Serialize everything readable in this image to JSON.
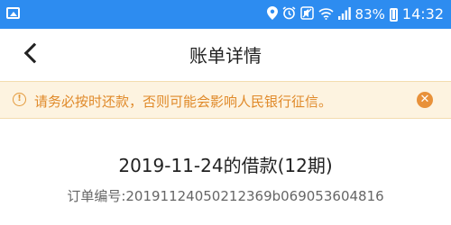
{
  "status_bar": {
    "battery_percent": "83%",
    "time": "14:32",
    "icons": [
      "location-icon",
      "alarm-icon",
      "mute-icon",
      "wifi-icon",
      "signal-icon",
      "battery-icon"
    ],
    "background_color": "#2d8cf0"
  },
  "nav": {
    "title": "账单详情",
    "back_icon": "chevron-left-icon"
  },
  "notice": {
    "text": "请务必按时还款，否则可能会影响人民银行征信。",
    "icon": "info-icon",
    "close_glyph": "✕",
    "color": "#e08a2a",
    "background_color": "#fdf3e0"
  },
  "loan": {
    "title": "2019-11-24的借款(12期)",
    "order_label": "订单编号:",
    "order_number": "20191124050212369b069053604816"
  }
}
